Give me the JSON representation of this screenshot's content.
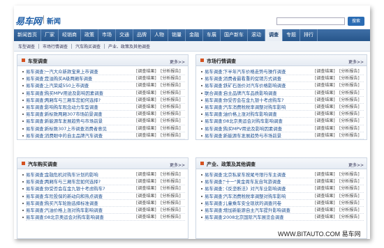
{
  "header": {
    "logo_text": "易车网",
    "section_title": "新闻",
    "search_placeholder": "",
    "search_button_label": "搜索"
  },
  "nav": {
    "items": [
      "新闻首页",
      "厂家",
      "经销商",
      "政策",
      "市场",
      "交通",
      "品牌",
      "人物",
      "销量",
      "金融",
      "车展",
      "国产新车",
      "滚动",
      "调查",
      "专题",
      "排行"
    ],
    "active_index": 13
  },
  "subnav": {
    "items": [
      "车型调查",
      "市场行情调查",
      "汽车购买调查",
      "产业、政策及其他调查"
    ]
  },
  "panels": [
    {
      "title": "车型调查",
      "more_label": "更多>>",
      "rows": [
        {
          "cat": "易车调查：",
          "title": "一汽大众新款宝来上市调查",
          "link1": "[调查结果]",
          "link2": "[分析报告]"
        },
        {
          "cat": "易车调查：",
          "title": "是油购买A级两厢车调查",
          "link1": "[调查结果]",
          "link2": "[分析报告]"
        },
        {
          "cat": "易车调查：",
          "title": "上汽荣威550上市调查",
          "link1": "[调查结果]",
          "link2": "[分析报告]"
        },
        {
          "cat": "易车调查：",
          "title": "购买MPV用途及影响因素调查",
          "link1": "[调查结果]",
          "link2": "[分析报告]"
        },
        {
          "cat": "易车调查：",
          "title": "两厢车与三厢车您如何选择?",
          "link1": "[调查结果]",
          "link2": "[分析报告]"
        },
        {
          "cat": "易车调查：",
          "title": "影响购车观念动力车型调查",
          "link1": "[调查结果]",
          "link2": "[分析报告]"
        },
        {
          "cat": "易车调查：",
          "title": "新标致两厢307市场前景调查",
          "link1": "[调查结果]",
          "link2": "[分析报告]"
        },
        {
          "cat": "易车调查：",
          "title": "新能源车发展趋势与市场前景",
          "link1": "[调查结果]",
          "link2": "[分析报告]"
        },
        {
          "cat": "易车调查：",
          "title": "新标致307上市调查消费者意见",
          "link1": "[调查结果]",
          "link2": "[分析报告]"
        },
        {
          "cat": "易车调查：",
          "title": "消费眼中的自主品牌汽车调查",
          "link1": "[调查结果]",
          "link2": "[分析报告]"
        }
      ]
    },
    {
      "title": "市场行情调查",
      "more_label": "更多>>",
      "rows": [
        {
          "cat": "易车调查：",
          "title": "下半年汽车价格走势与操作调查",
          "link1": "[调查结果]",
          "link2": "[分析报告]"
        },
        {
          "cat": "易车调查：",
          "title": "消费者最看重的促销方式调查",
          "link1": "[调查结果]",
          "link2": "[分析报告]"
        },
        {
          "cat": "易车调查：",
          "title": "铁矿石涨价对汽车价格影响调查",
          "link1": "[调查结果]",
          "link2": "[分析报告]"
        },
        {
          "cat": "联合调查：",
          "title": "自主品牌汽车品质影响调查",
          "link1": "[调查结果]",
          "link2": "[分析报告]"
        },
        {
          "cat": "易车调查：",
          "title": "你受否会在金九银十考虑购车?",
          "link1": "[调查结果]",
          "link2": "[分析报告]"
        },
        {
          "cat": "易车调查：",
          "title": "汽车消费税税率调整对购车影响",
          "link1": "[调查结果]",
          "link2": "[分析报告]"
        },
        {
          "cat": "易车调查：",
          "title": "油价格上涨对购车影响调查",
          "link1": "[调查结果]",
          "link2": "[分析报告]"
        },
        {
          "cat": "易车调查：",
          "title": "08北京奥运会对购车影响调查",
          "link1": "[调查结果]",
          "link2": "[分析报告]"
        },
        {
          "cat": "易车调查：",
          "title": "购买MPV用途及影响因素调查",
          "link1": "[调查结果]",
          "link2": "[分析报告]"
        },
        {
          "cat": "易车调查：",
          "title": "新能源车发展趋势与市场前景",
          "link1": "[调查结果]",
          "link2": "[分析报告]"
        }
      ]
    },
    {
      "title": "汽车购买调查",
      "more_label": "更多>>",
      "rows": [
        {
          "cat": "易车调查：",
          "title": "金融危机对购车计划的影响",
          "link1": "[调查结果]",
          "link2": "[分析报告]"
        },
        {
          "cat": "易车调查：",
          "title": "两厢车与三厢车您如何选择?",
          "link1": "[调查结果]",
          "link2": "[分析报告]"
        },
        {
          "cat": "易车调查：",
          "title": "你受否会在金九银十考虑购车?",
          "link1": "[调查结果]",
          "link2": "[分析报告]"
        },
        {
          "cat": "易车调查：",
          "title": "车险投保的新动向和热点调查",
          "link1": "[调查结果]",
          "link2": "[分析报告]"
        },
        {
          "cat": "易车调查：",
          "title": "购买汽车轮胎选择标准调查",
          "link1": "[调查结果]",
          "link2": "[分析报告]"
        },
        {
          "cat": "易车调查：",
          "title": "汽油价格上涨对购车影响调查",
          "link1": "[调查结果]",
          "link2": "[分析报告]"
        },
        {
          "cat": "易车调查：",
          "title": "08北京奥运会对购车影响调查",
          "link1": "[调查结果]",
          "link2": "[分析报告]"
        }
      ]
    },
    {
      "title": "产业、政策及其他调查",
      "more_label": "更多>>",
      "rows": [
        {
          "cat": "易车调查：",
          "title": "北京私家车按尾号限行车主调查",
          "link1": "[调查结果]",
          "link2": "[分析报告]"
        },
        {
          "cat": "易车调查：",
          "title": "\"十一\"黄金周车友自驾游调查",
          "link1": "[调查结果]",
          "link2": "[分析报告]"
        },
        {
          "cat": "易车调查：",
          "title": "《反垄断法》对汽车业影响调查",
          "link1": "[调查结果]",
          "link2": "[分析报告]"
        },
        {
          "cat": "易车调查：",
          "title": "汽车消费税税率调整对购车影响",
          "link1": "[调查结果]",
          "link2": "[分析报告]"
        },
        {
          "cat": "易车调查：",
          "title": "儿童乘车安全现状的调查问卷",
          "link1": "[调查结果]",
          "link2": "[分析报告]"
        },
        {
          "cat": "易车调查：",
          "title": "增加新能源自主汽车提升影响调查",
          "link1": "[调查结果]",
          "link2": "[分析报告]"
        },
        {
          "cat": "易车调查：",
          "title": "2008北京国际汽车展览会调查",
          "link1": "[调查结果]",
          "link2": "[分析报告]"
        }
      ]
    }
  ],
  "watermark": "WWW.BITAUTO.COM 易车网"
}
